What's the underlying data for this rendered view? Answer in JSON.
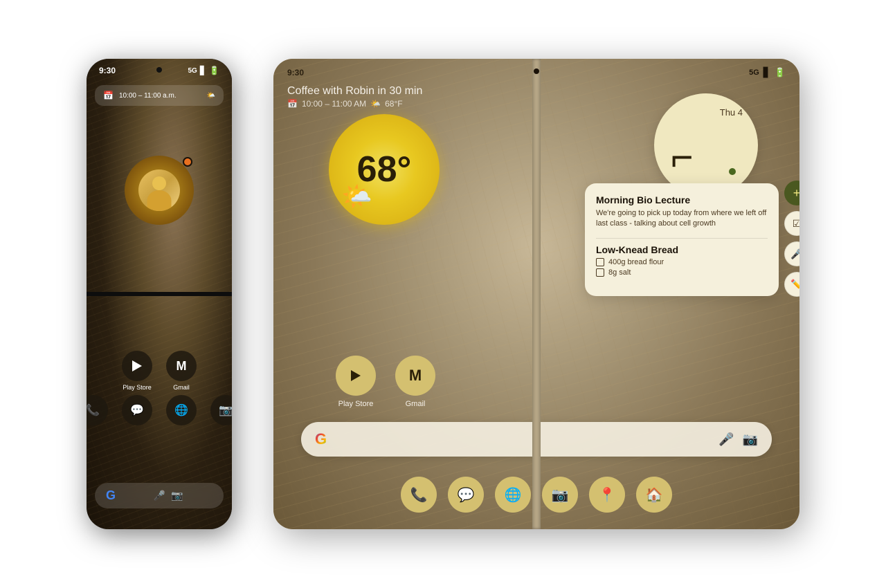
{
  "phone": {
    "time": "9:30",
    "signal": "5G",
    "notification": {
      "time": "10:00 – 11:00 a.m.",
      "icon": "📅"
    },
    "apps_row1": [
      {
        "id": "play-store",
        "label": "Play Store",
        "icon": "play"
      },
      {
        "id": "gmail",
        "label": "Gmail",
        "icon": "gmail"
      }
    ],
    "apps_row2": [
      {
        "id": "phone",
        "label": "",
        "icon": "📞"
      },
      {
        "id": "messages",
        "label": "",
        "icon": "💬"
      },
      {
        "id": "chrome",
        "label": "",
        "icon": "🌐"
      },
      {
        "id": "camera",
        "label": "",
        "icon": "📷"
      }
    ],
    "dock": {
      "g_label": "G",
      "mic_icon": "🎤",
      "camera_icon": "📷"
    }
  },
  "tablet": {
    "time": "9:30",
    "signal": "5G",
    "notification": {
      "title": "Coffee with Robin in 30 min",
      "subtitle_time": "10:00 – 11:00 AM",
      "subtitle_weather": "68°F",
      "calendar_icon": "📅",
      "weather_icon": "🌤️"
    },
    "weather": {
      "temp": "68°",
      "icon": "🌤️"
    },
    "clock": {
      "day": "Thu 4",
      "time_display": "⌐"
    },
    "notes": {
      "note1_title": "Morning Bio Lecture",
      "note1_text": "We're going to pick up today from where we left off last class - talking about cell growth",
      "note2_title": "Low-Knead Bread",
      "note2_item1": "400g bread flour",
      "note2_item2": "8g salt"
    },
    "apps": [
      {
        "id": "play-store",
        "label": "Play Store",
        "icon": "play"
      },
      {
        "id": "gmail",
        "label": "Gmail",
        "icon": "gmail"
      }
    ],
    "dock": [
      {
        "id": "phone",
        "icon": "📞"
      },
      {
        "id": "messages",
        "icon": "💬"
      },
      {
        "id": "chrome",
        "icon": "🌐"
      },
      {
        "id": "camera-app",
        "icon": "📷"
      },
      {
        "id": "maps",
        "icon": "📍"
      },
      {
        "id": "home",
        "icon": "🏠"
      }
    ],
    "search": {
      "g_label": "G",
      "mic": "🎤",
      "lens": "📷"
    }
  }
}
